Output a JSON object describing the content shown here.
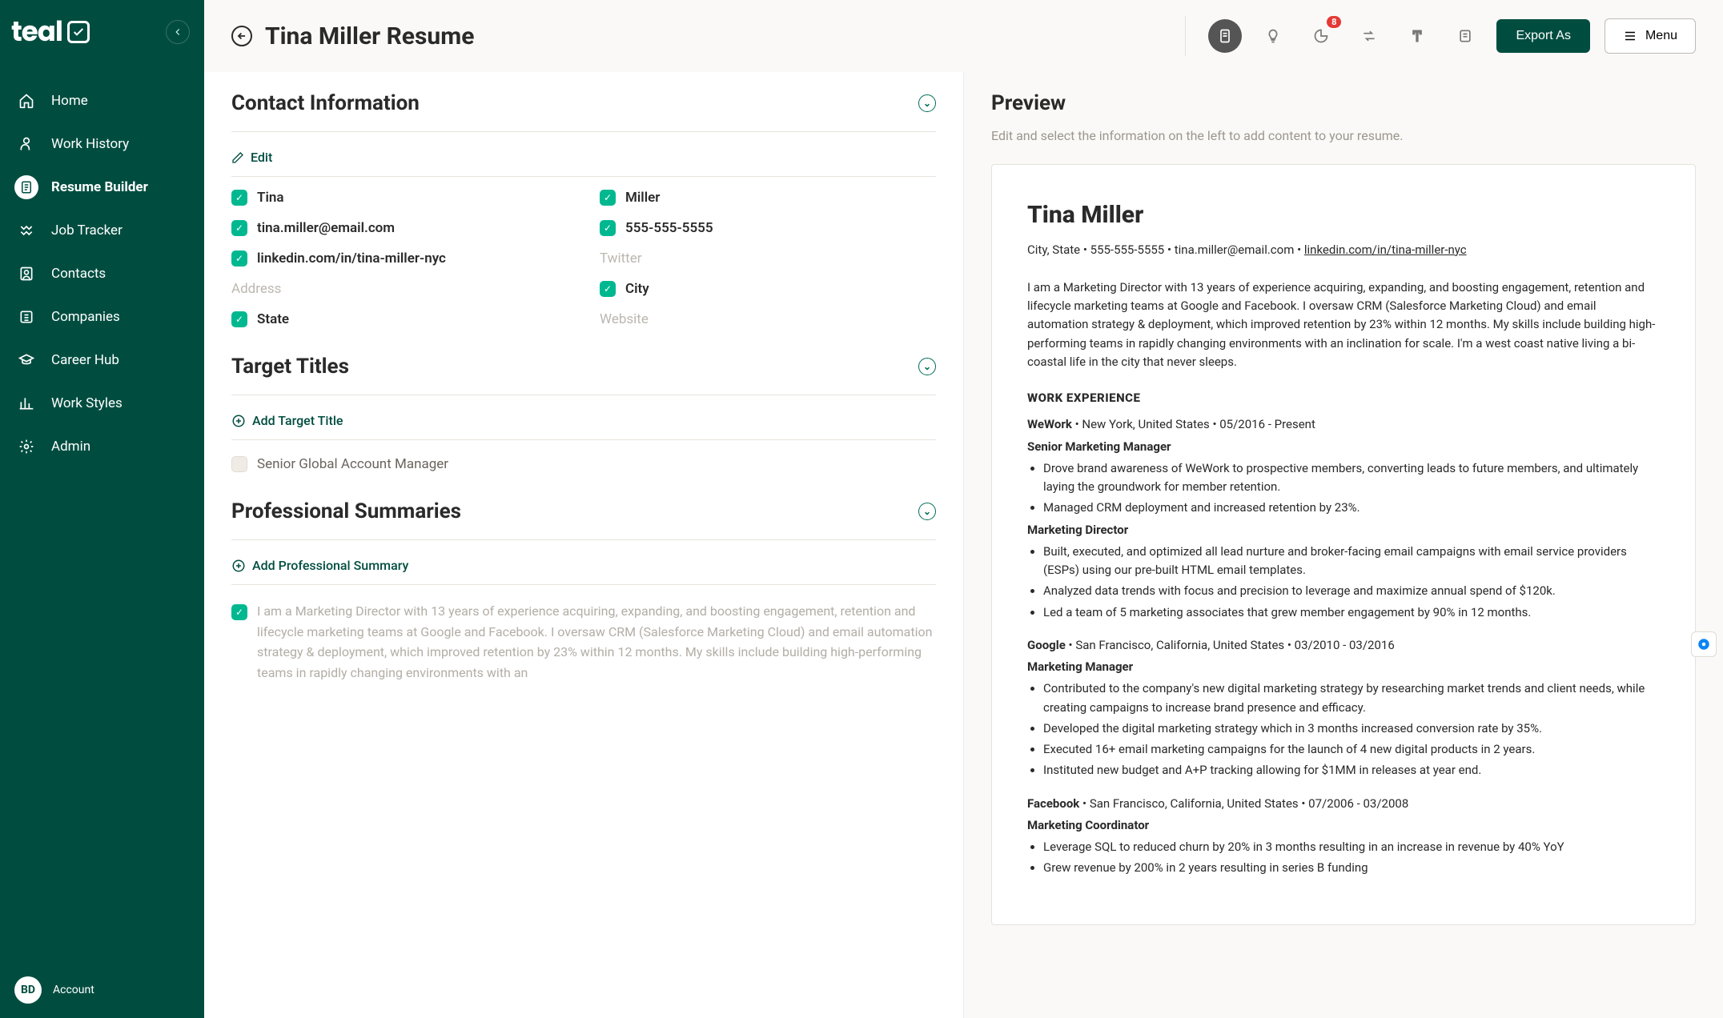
{
  "sidebar": {
    "logo": "teal",
    "items": [
      {
        "label": "Home"
      },
      {
        "label": "Work History"
      },
      {
        "label": "Resume Builder"
      },
      {
        "label": "Job Tracker"
      },
      {
        "label": "Contacts"
      },
      {
        "label": "Companies"
      },
      {
        "label": "Career Hub"
      },
      {
        "label": "Work Styles"
      },
      {
        "label": "Admin"
      }
    ],
    "account_label": "Account",
    "account_initials": "BD"
  },
  "header": {
    "title": "Tina Miller Resume",
    "badge": "8",
    "export": "Export As",
    "menu": "Menu"
  },
  "contact": {
    "section_title": "Contact Information",
    "edit": "Edit",
    "first_name": "Tina",
    "last_name": "Miller",
    "email": "tina.miller@email.com",
    "phone": "555-555-5555",
    "linkedin": "linkedin.com/in/tina-miller-nyc",
    "twitter_placeholder": "Twitter",
    "address_placeholder": "Address",
    "city": "City",
    "state": "State",
    "website_placeholder": "Website"
  },
  "target_titles": {
    "section_title": "Target Titles",
    "add": "Add Target Title",
    "items": [
      {
        "label": "Senior Global Account Manager"
      }
    ]
  },
  "summaries": {
    "section_title": "Professional Summaries",
    "add": "Add Professional Summary",
    "text": "I am a Marketing Director with 13 years of experience acquiring, expanding, and boosting engagement, retention and lifecycle marketing teams at Google and Facebook. I oversaw CRM (Salesforce Marketing Cloud) and email automation strategy & deployment, which improved retention by 23% within 12 months. My skills include building high-performing teams in rapidly changing environments with an"
  },
  "preview": {
    "title": "Preview",
    "hint": "Edit and select the information on the left to add content to your resume.",
    "name": "Tina Miller",
    "contact_prefix": "City, State • 555-555-5555 • tina.miller@email.com • ",
    "contact_link": "linkedin.com/in/tina-miller-nyc",
    "summary": "I am a Marketing Director with 13 years of experience acquiring, expanding, and boosting engagement, retention and lifecycle marketing teams at Google and Facebook. I oversaw CRM (Salesforce Marketing Cloud) and email automation strategy & deployment, which improved retention by 23% within 12 months. My skills include building high-performing teams in rapidly changing environments with an inclination for scale. I'm a west coast native living a bi-coastal life in the city that never sleeps.",
    "work_experience_h": "WORK EXPERIENCE",
    "jobs": [
      {
        "company": "WeWork",
        "meta": " • New York, United States • 05/2016 - Present",
        "roles": [
          {
            "title": "Senior Marketing Manager",
            "bullets": [
              "Drove brand awareness of WeWork to prospective members, converting leads to future members, and ultimately laying the groundwork for member retention.",
              "Managed CRM deployment and increased retention by 23%."
            ]
          },
          {
            "title": "Marketing Director",
            "bullets": [
              "Built, executed, and optimized all lead nurture and broker-facing email campaigns with email service providers (ESPs) using our pre-built HTML email templates.",
              "Analyzed data trends with focus and precision to leverage and maximize annual spend of $120k.",
              "Led a team of 5 marketing associates that grew member engagement by 90% in 12 months."
            ]
          }
        ]
      },
      {
        "company": "Google",
        "meta": " • San Francisco, California, United States • 03/2010 - 03/2016",
        "roles": [
          {
            "title": "Marketing Manager",
            "bullets": [
              "Contributed to the company's new digital marketing strategy by researching market trends and client needs, while creating campaigns to increase brand presence and efficacy.",
              "Developed the digital marketing strategy which in 3 months increased conversion rate by 35%.",
              "Executed 16+ email marketing campaigns for the launch of 4 new digital products in 2 years.",
              "Instituted new budget and A+P tracking allowing for $1MM in releases at year end."
            ]
          }
        ]
      },
      {
        "company": "Facebook",
        "meta": " • San Francisco, California, United States • 07/2006 - 03/2008",
        "roles": [
          {
            "title": "Marketing Coordinator",
            "bullets": [
              "Leverage SQL to reduced churn by 20% in 3 months resulting in an increase in revenue by 40% YoY",
              "Grew revenue by 200% in 2 years resulting in series B funding"
            ]
          }
        ]
      }
    ]
  }
}
